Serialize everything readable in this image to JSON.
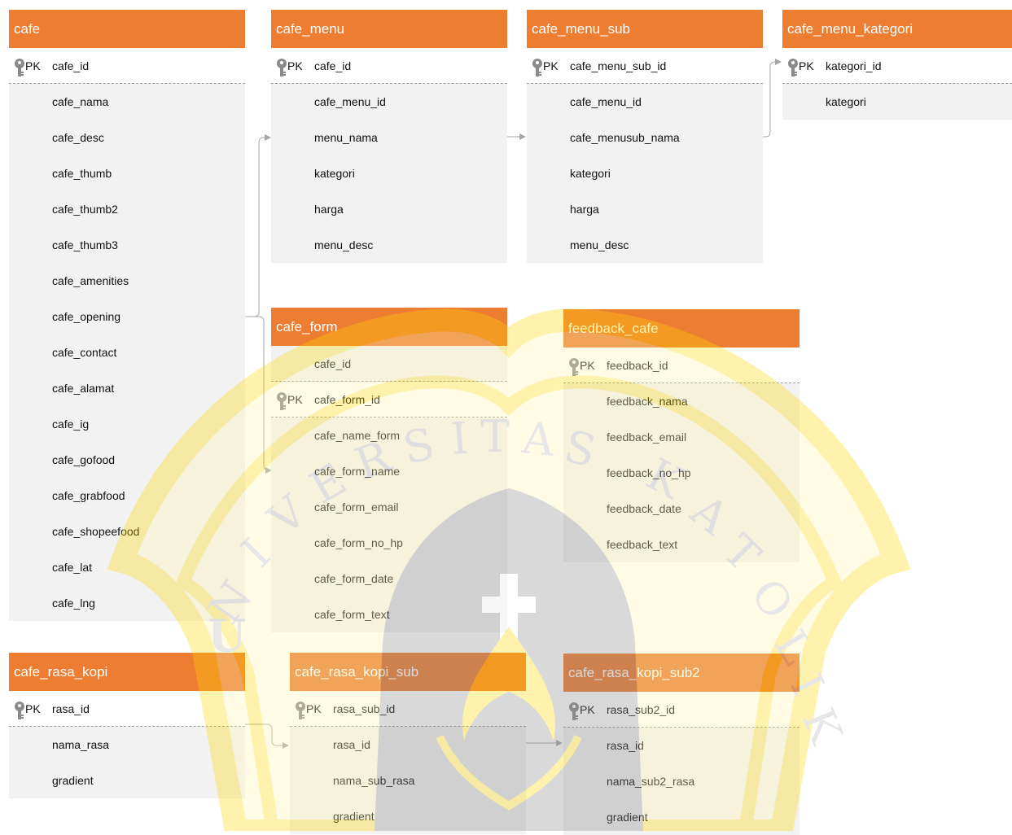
{
  "pk_label": "PK",
  "colors": {
    "header_bg": "#ed7d31",
    "header_text": "#ffffff",
    "row_bg": "#f2f2f2",
    "pk_row_bg": "#ffffff",
    "connector": "#a6a6a6",
    "watermark": "#ffd700"
  },
  "icons": {
    "primary_key": "key-icon"
  },
  "watermark_text": "UNIVERSITAS KATOLIK",
  "tables": [
    {
      "id": "cafe",
      "title": "cafe",
      "fields": [
        {
          "name": "cafe_id",
          "pk": true
        },
        {
          "name": "cafe_nama"
        },
        {
          "name": "cafe_desc"
        },
        {
          "name": "cafe_thumb"
        },
        {
          "name": "cafe_thumb2"
        },
        {
          "name": "cafe_thumb3"
        },
        {
          "name": "cafe_amenities"
        },
        {
          "name": "cafe_opening"
        },
        {
          "name": "cafe_contact"
        },
        {
          "name": "cafe_alamat"
        },
        {
          "name": "cafe_ig"
        },
        {
          "name": "cafe_gofood"
        },
        {
          "name": "cafe_grabfood"
        },
        {
          "name": "cafe_shopeefood"
        },
        {
          "name": "cafe_lat"
        },
        {
          "name": "cafe_lng"
        }
      ]
    },
    {
      "id": "cafe_menu",
      "title": "cafe_menu",
      "fields": [
        {
          "name": "cafe_id",
          "pk": true
        },
        {
          "name": "cafe_menu_id"
        },
        {
          "name": "menu_nama"
        },
        {
          "name": "kategori"
        },
        {
          "name": "harga"
        },
        {
          "name": "menu_desc"
        }
      ]
    },
    {
      "id": "cafe_menu_sub",
      "title": "cafe_menu_sub",
      "fields": [
        {
          "name": "cafe_menu_sub_id",
          "pk": true
        },
        {
          "name": "cafe_menu_id"
        },
        {
          "name": "cafe_menusub_nama"
        },
        {
          "name": "kategori"
        },
        {
          "name": "harga"
        },
        {
          "name": "menu_desc"
        }
      ]
    },
    {
      "id": "cafe_menu_kategori",
      "title": "cafe_menu_kategori",
      "fields": [
        {
          "name": "kategori_id",
          "pk": true
        },
        {
          "name": "kategori"
        }
      ]
    },
    {
      "id": "cafe_form",
      "title": "cafe_form",
      "fields": [
        {
          "name": "cafe_id"
        },
        {
          "name": "cafe_form_id",
          "pk": true
        },
        {
          "name": "cafe_name_form"
        },
        {
          "name": "cafe_form_name"
        },
        {
          "name": "cafe_form_email"
        },
        {
          "name": "cafe_form_no_hp"
        },
        {
          "name": "cafe_form_date"
        },
        {
          "name": "cafe_form_text"
        }
      ]
    },
    {
      "id": "feedback_cafe",
      "title": "feedback_cafe",
      "fields": [
        {
          "name": "feedback_id",
          "pk": true
        },
        {
          "name": "feedback_nama"
        },
        {
          "name": "feedback_email"
        },
        {
          "name": "feedback_no_hp"
        },
        {
          "name": "feedback_date"
        },
        {
          "name": "feedback_text"
        }
      ]
    },
    {
      "id": "cafe_rasa_kopi",
      "title": "cafe_rasa_kopi",
      "fields": [
        {
          "name": "rasa_id",
          "pk": true
        },
        {
          "name": "nama_rasa"
        },
        {
          "name": "gradient"
        }
      ]
    },
    {
      "id": "cafe_rasa_kopi_sub",
      "title": "cafe_rasa_kopi_sub",
      "fields": [
        {
          "name": "rasa_sub_id",
          "pk": true
        },
        {
          "name": "rasa_id"
        },
        {
          "name": "nama_sub_rasa"
        },
        {
          "name": "gradient"
        }
      ]
    },
    {
      "id": "cafe_rasa_kopi_sub2",
      "title": "cafe_rasa_kopi_sub2",
      "fields": [
        {
          "name": "rasa_sub2_id",
          "pk": true
        },
        {
          "name": "rasa_id"
        },
        {
          "name": "nama_sub2_rasa"
        },
        {
          "name": "gradient"
        }
      ]
    }
  ],
  "relationships": [
    {
      "from": "cafe",
      "to": "cafe_menu"
    },
    {
      "from": "cafe",
      "to": "cafe_form"
    },
    {
      "from": "cafe_menu",
      "to": "cafe_menu_sub"
    },
    {
      "from": "cafe_menu_sub",
      "to": "cafe_menu_kategori"
    },
    {
      "from": "cafe_rasa_kopi",
      "to": "cafe_rasa_kopi_sub"
    },
    {
      "from": "cafe_rasa_kopi_sub",
      "to": "cafe_rasa_kopi_sub2"
    }
  ]
}
